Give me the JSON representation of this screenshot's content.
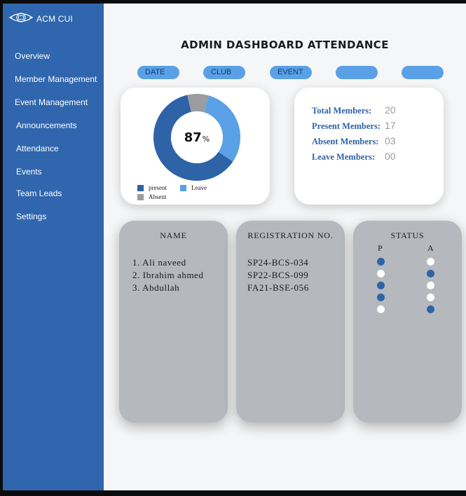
{
  "brand": {
    "name": "ACM CUI",
    "logo_icon": "acm-logo-icon"
  },
  "sidebar": {
    "items": [
      {
        "label": "Overview"
      },
      {
        "label": "Member Management"
      },
      {
        "label": "Event Management"
      },
      {
        "label": "Announcements"
      },
      {
        "label": "Attendance"
      },
      {
        "label": "Events"
      },
      {
        "label": "Team Leads"
      },
      {
        "label": "Settings"
      }
    ]
  },
  "header": {
    "title": "ADMIN DASHBOARD ATTENDANCE"
  },
  "filters": [
    {
      "label": "DATE"
    },
    {
      "label": "CLUB"
    },
    {
      "label": "EVENT"
    },
    {
      "label": ""
    },
    {
      "label": ""
    }
  ],
  "summary": {
    "percent_value": "87",
    "percent_sign": "%",
    "legend": [
      {
        "label": "present",
        "color": "#2e63a8"
      },
      {
        "label": "Leave",
        "color": "#5aa0e6"
      },
      {
        "label": "Absent",
        "color": "#9a9ca0"
      }
    ]
  },
  "chart_data": {
    "type": "pie",
    "donut": true,
    "center_label": "87%",
    "slices": [
      {
        "label": "present",
        "value": 62,
        "color": "#2e63a8"
      },
      {
        "label": "Absent",
        "value": 8,
        "color": "#9a9ca0"
      },
      {
        "label": "Leave",
        "value": 30,
        "color": "#5aa0e6"
      }
    ]
  },
  "stats": {
    "total_label": "Total Members:",
    "total_value": "20",
    "present_label": "Present Members:",
    "present_value": "17",
    "absent_label": "Absent Members:",
    "absent_value": "03",
    "leave_label": "Leave Members:",
    "leave_value": "00"
  },
  "table": {
    "name_header": "NAME",
    "reg_header": "REGISTRATION NO.",
    "status_header": "STATUS",
    "p_label": "P",
    "a_label": "A",
    "rows": [
      {
        "name": "1. Ali naveed",
        "reg": "SP24-BCS-034"
      },
      {
        "name": "2. Ibrahim ahmed",
        "reg": "SP22-BCS-099"
      },
      {
        "name": "3. Abdullah",
        "reg": "FA21-BSE-056"
      }
    ],
    "status_rows": [
      {
        "p": true,
        "a": false
      },
      {
        "p": false,
        "a": true
      },
      {
        "p": true,
        "a": false
      },
      {
        "p": true,
        "a": false
      },
      {
        "p": false,
        "a": true
      }
    ]
  }
}
